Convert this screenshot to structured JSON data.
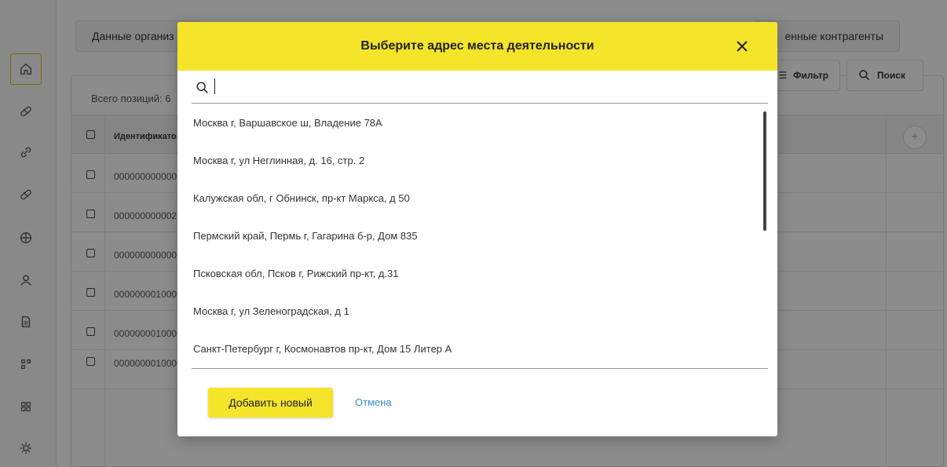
{
  "background": {
    "tabs": [
      {
        "label": "Данные организ"
      },
      {
        "label": "енные контрагенты"
      }
    ],
    "toolbar": {
      "filter_label": "Фильтр",
      "search_label": "Поиск"
    },
    "total_label": "Всего позиций: 6",
    "table": {
      "columns": [
        "Идентификато"
      ],
      "rows": [
        {
          "id": "000000000000"
        },
        {
          "id": "000000000002"
        },
        {
          "id": "000000000000"
        },
        {
          "id": "000000001000"
        },
        {
          "id": "000000001000"
        },
        {
          "id": "000000001000"
        }
      ]
    },
    "sidebar_icons": [
      "home-icon",
      "pill-icon",
      "link-icon",
      "pill-icon",
      "globe-icon",
      "user-icon",
      "document-icon",
      "hierarchy-icon",
      "grid-icon",
      "gear-icon"
    ]
  },
  "modal": {
    "title": "Выберите адрес места деятельности",
    "search": {
      "value": "",
      "placeholder": ""
    },
    "addresses": [
      "Москва г, Варшавское ш, Владение 78А",
      "Москва г, ул Неглинная, д. 16, стр. 2",
      "Калужская обл, г Обнинск, пр-кт Маркса, д 50",
      "Пермский край, Пермь г, Гагарина б-р, Дом 835",
      "Псковская обл, Псков г, Рижский пр-кт, д.31",
      "Москва г, ул Зеленоградская, д 1",
      "Санкт-Петербург г, Космонавтов пр-кт, Дом 15 Литер А"
    ],
    "add_button": "Добавить новый",
    "cancel_button": "Отмена"
  },
  "colors": {
    "accent": "#f5e52a",
    "link": "#3a8ec4"
  }
}
